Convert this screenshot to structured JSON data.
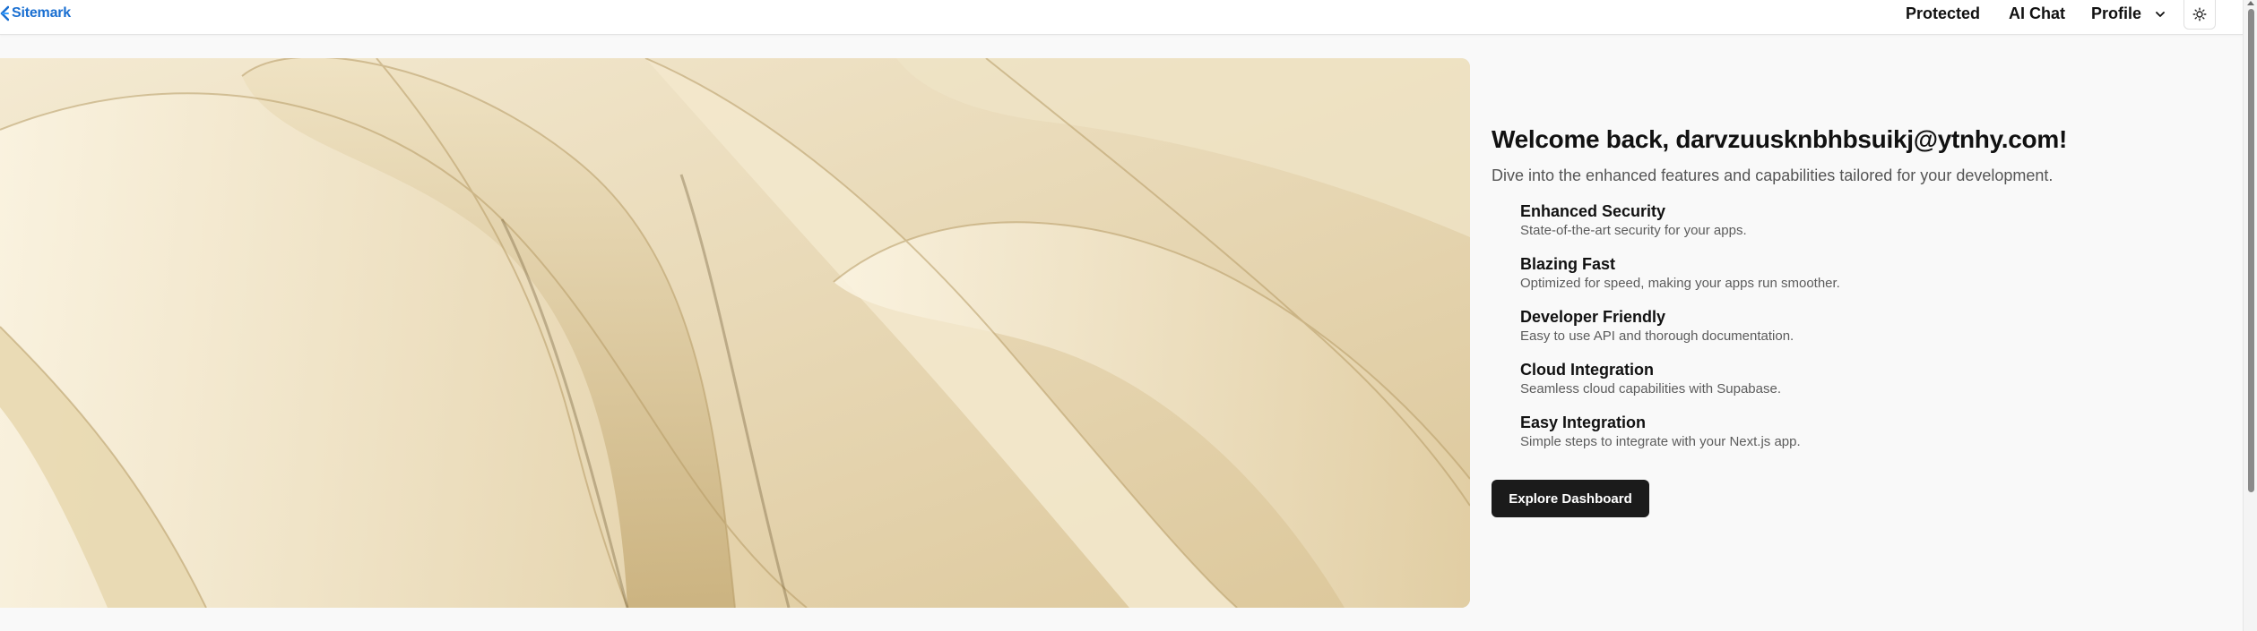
{
  "header": {
    "brand": "Sitemark",
    "brand_color": "#1a6fd1",
    "nav": {
      "protected": "Protected",
      "ai_chat": "AI Chat",
      "profile": "Profile"
    },
    "theme_toggle_icon": "sun-icon"
  },
  "hero": {
    "image": "abstract cream paper folds"
  },
  "welcome": {
    "title": "Welcome back, darvzuusknbhbsuikj@ytnhy.com!",
    "subtitle": "Dive into the enhanced features and capabilities tailored for your development.",
    "features": [
      {
        "title": "Enhanced Security",
        "desc": "State-of-the-art security for your apps."
      },
      {
        "title": "Blazing Fast",
        "desc": "Optimized for speed, making your apps run smoother."
      },
      {
        "title": "Developer Friendly",
        "desc": "Easy to use API and thorough documentation."
      },
      {
        "title": "Cloud Integration",
        "desc": "Seamless cloud capabilities with Supabase."
      },
      {
        "title": "Easy Integration",
        "desc": "Simple steps to integrate with your Next.js app."
      }
    ],
    "cta_label": "Explore Dashboard"
  }
}
